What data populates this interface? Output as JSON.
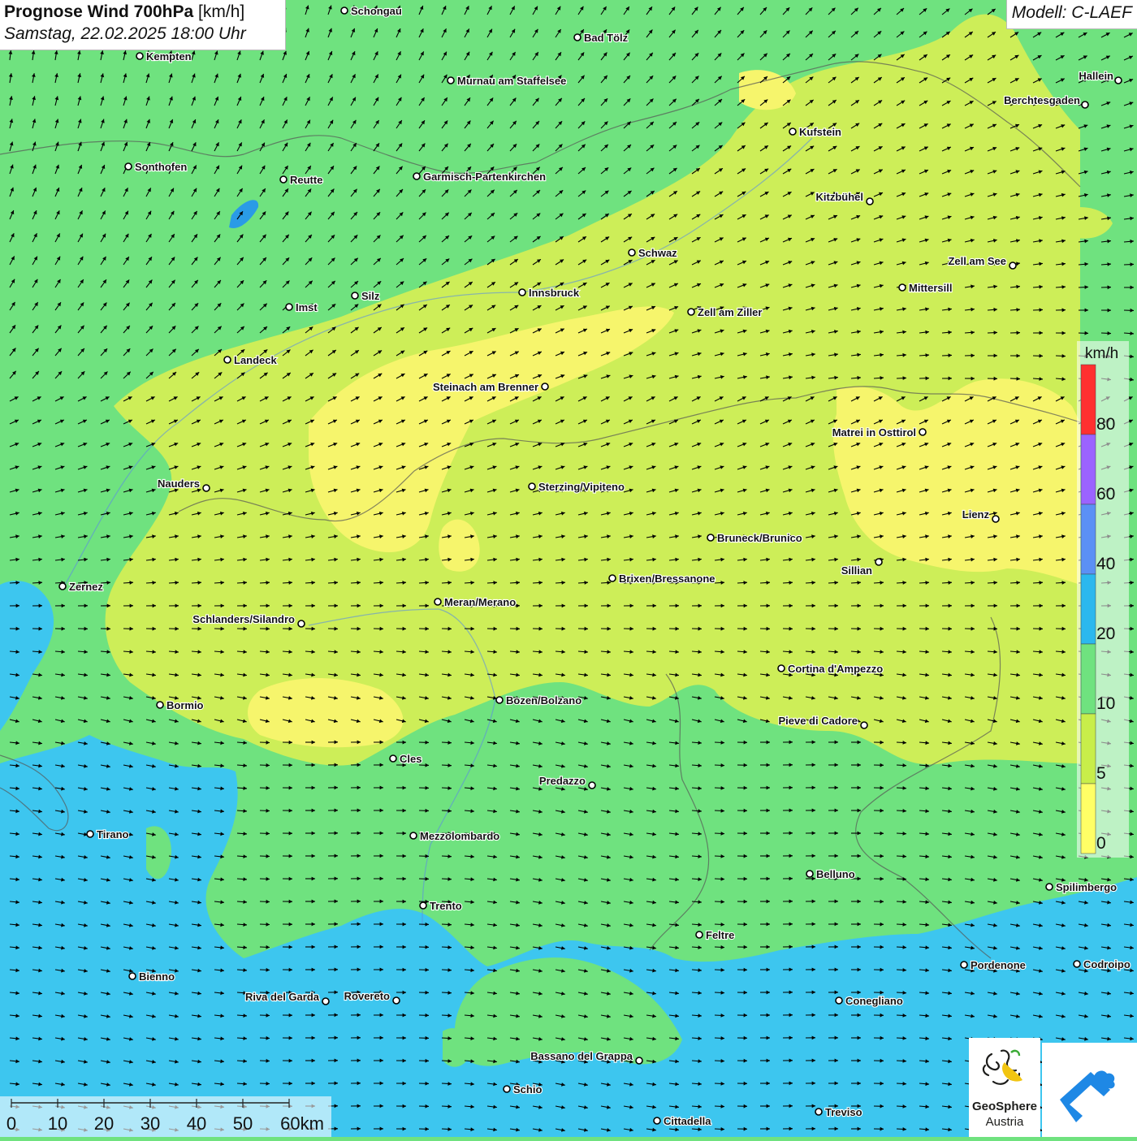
{
  "header": {
    "title_bold": "Prognose Wind 700hPa",
    "title_unit": "[km/h]",
    "subtitle": "Samstag, 22.02.2025 18:00 Uhr",
    "model": "Modell: C-LAEF"
  },
  "legend": {
    "unit": "km/h",
    "ticks": [
      "80",
      "60",
      "40",
      "20",
      "10",
      "5",
      "0"
    ],
    "colors": [
      "#ff3030",
      "#9b63ff",
      "#5b90f5",
      "#2bb8ee",
      "#6fe27f",
      "#c8ee4a",
      "#ffff66"
    ]
  },
  "scale_bar": {
    "labels": [
      "0",
      "10",
      "20",
      "30",
      "40",
      "50",
      "60km"
    ]
  },
  "logos": {
    "brand_line1": "GeoSphere",
    "brand_line2": "Austria"
  },
  "colors": {
    "calm": "#f6f56c",
    "light": "#cdee58",
    "moderate": "#6fe27f",
    "fresh": "#3dc6ef",
    "arrow": "#000000"
  },
  "cities": [
    {
      "name": "Schongau"
    },
    {
      "name": "Bad Tölz"
    },
    {
      "name": "Kempten"
    },
    {
      "name": "Murnau am Staffelsee"
    },
    {
      "name": "Hallein"
    },
    {
      "name": "Berchtesgaden"
    },
    {
      "name": "Kufstein"
    },
    {
      "name": "Sonthofen"
    },
    {
      "name": "Reutte"
    },
    {
      "name": "Garmisch-Partenkirchen"
    },
    {
      "name": "Kitzbühel"
    },
    {
      "name": "Schwaz"
    },
    {
      "name": "Zell am See"
    },
    {
      "name": "Mittersill"
    },
    {
      "name": "Innsbruck"
    },
    {
      "name": "Silz"
    },
    {
      "name": "Imst"
    },
    {
      "name": "Zell am Ziller"
    },
    {
      "name": "Landeck"
    },
    {
      "name": "Steinach am Brenner"
    },
    {
      "name": "Matrei in Osttirol"
    },
    {
      "name": "Nauders"
    },
    {
      "name": "Sterzing/Vipiteno"
    },
    {
      "name": "Lienz"
    },
    {
      "name": "Bruneck/Brunico"
    },
    {
      "name": "Sillian"
    },
    {
      "name": "Zernez"
    },
    {
      "name": "Brixen/Bressanone"
    },
    {
      "name": "Meran/Merano"
    },
    {
      "name": "Schlanders/Silandro"
    },
    {
      "name": "Cortina d'Ampezzo"
    },
    {
      "name": "Bozen/Bolzano"
    },
    {
      "name": "Bormio"
    },
    {
      "name": "Pieve di Cadore"
    },
    {
      "name": "Cles"
    },
    {
      "name": "Predazzo"
    },
    {
      "name": "Tirano"
    },
    {
      "name": "Mezzolombardo"
    },
    {
      "name": "Belluno"
    },
    {
      "name": "Spilimbergo"
    },
    {
      "name": "Trento"
    },
    {
      "name": "Feltre"
    },
    {
      "name": "Pordenone"
    },
    {
      "name": "Codroipo"
    },
    {
      "name": "Bienno"
    },
    {
      "name": "Riva del Garda"
    },
    {
      "name": "Rovereto"
    },
    {
      "name": "Conegliano"
    },
    {
      "name": "Bassano del Grappa"
    },
    {
      "name": "Schio"
    },
    {
      "name": "Treviso"
    },
    {
      "name": "Cittadella"
    }
  ]
}
